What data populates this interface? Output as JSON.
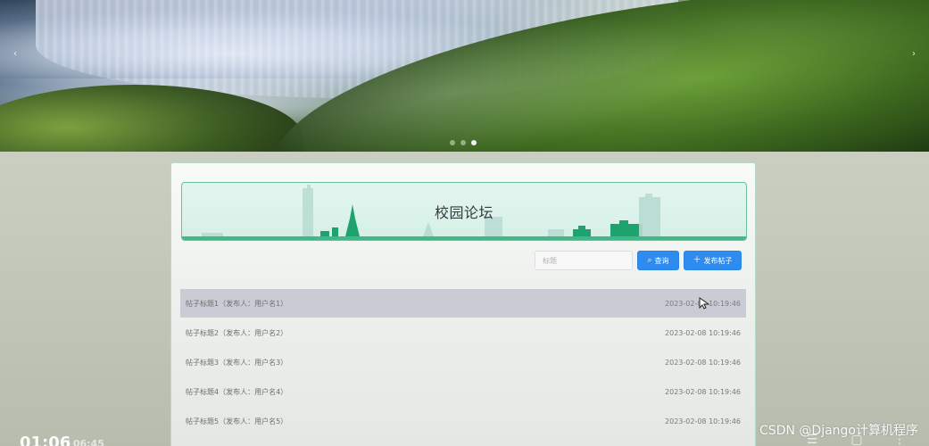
{
  "hero": {
    "carousel_dots": 3,
    "active_dot_index": 2,
    "arrow_left": "‹",
    "arrow_right": "›"
  },
  "banner": {
    "title": "校园论坛"
  },
  "toolbar": {
    "search_placeholder": "标题",
    "search_button_label": "查询",
    "post_button_label": "发布帖子"
  },
  "posts": [
    {
      "title": "帖子标题1（发布人：用户名1）",
      "time": "2023-02-08 10:19:46"
    },
    {
      "title": "帖子标题2（发布人：用户名2）",
      "time": "2023-02-08 10:19:46"
    },
    {
      "title": "帖子标题3（发布人：用户名3）",
      "time": "2023-02-08 10:19:46"
    },
    {
      "title": "帖子标题4（发布人：用户名4）",
      "time": "2023-02-08 10:19:46"
    },
    {
      "title": "帖子标题5（发布人：用户名5）",
      "time": "2023-02-08 10:19:46"
    }
  ],
  "video_overlay": {
    "current_time": "01:06",
    "total_time": "/ 06:45",
    "watermark": "CSDN @Django计算机程序"
  },
  "colors": {
    "accent": "#2e8bf0",
    "banner_border": "#69bfa0",
    "banner_bg": "#d6f0e6",
    "row_hover": "#c9ccd4"
  }
}
